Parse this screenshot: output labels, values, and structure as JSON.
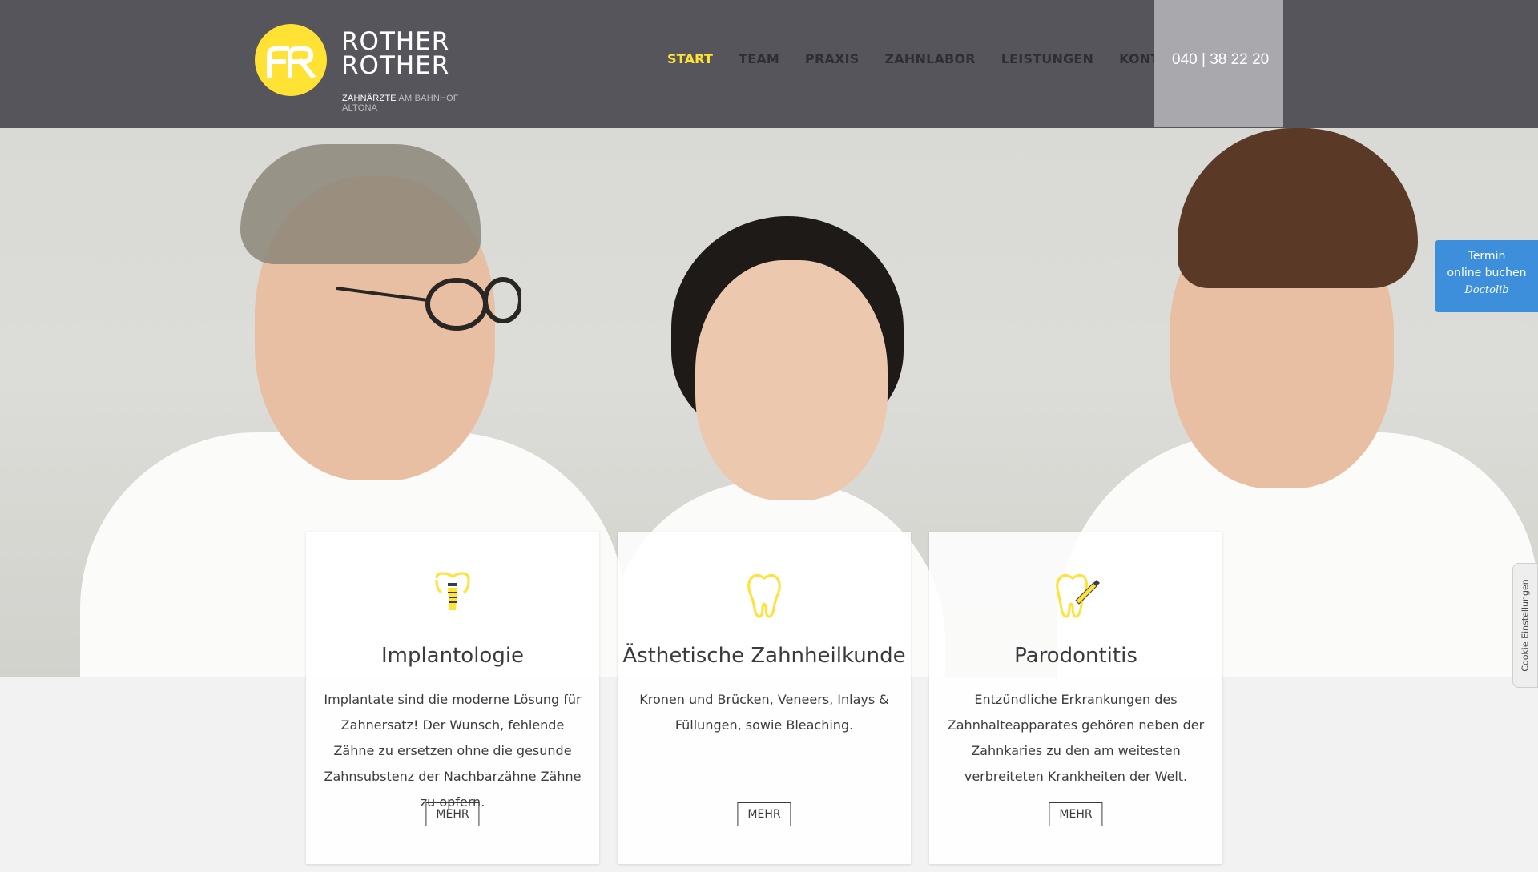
{
  "logo": {
    "line1": "ROTHER",
    "line2": "ROTHER",
    "sub_bold": "ZAHNÄRZTE",
    "sub_light": "AM BAHNHOF ALTONA"
  },
  "nav": {
    "items": [
      {
        "label": "START"
      },
      {
        "label": "TEAM"
      },
      {
        "label": "PRAXIS"
      },
      {
        "label": "ZAHNLABOR"
      },
      {
        "label": "LEISTUNGEN"
      },
      {
        "label": "KONTAKT"
      }
    ],
    "active_index": 0
  },
  "phone": "040 | 38 22 20",
  "cards": [
    {
      "icon": "tooth-implant-icon",
      "title": "Implantologie",
      "text": "Implantate sind die moderne Lösung für Zahnersatz! Der Wunsch, fehlende Zähne zu ersetzen ohne die gesunde Zahnsubstenz der Nachbarzähne Zähne zu opfern.",
      "button": "MEHR"
    },
    {
      "icon": "tooth-icon",
      "title": "Ästhetische Zahnheilkunde",
      "text": "Kronen und Brücken, Veneers, Inlays & Füllungen, sowie Bleaching.",
      "button": "MEHR"
    },
    {
      "icon": "tooth-pencil-icon",
      "title": "Parodontitis",
      "text": "Entzündliche Erkrankungen des Zahnhalteapparates gehören neben der Zahnkaries zu den am weitesten verbreiteten Krankheiten der Welt.",
      "button": "MEHR"
    }
  ],
  "booking": {
    "line1": "Termin",
    "line2": "online buchen",
    "brand": "Doctolib"
  },
  "cookie": "Cookie Einstellungen",
  "colors": {
    "header_bg": "#56555c",
    "accent_yellow": "#ffe234",
    "phone_bg": "#a9a8ad",
    "booking_blue": "#3d8fdb"
  }
}
